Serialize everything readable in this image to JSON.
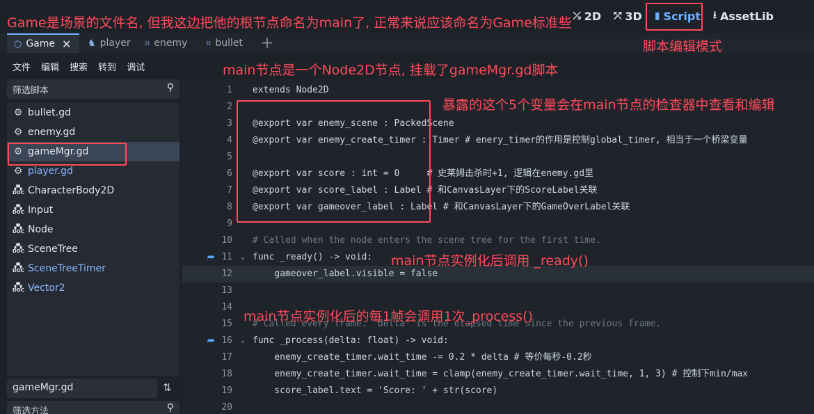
{
  "topbar": {
    "modes": [
      {
        "icon": "2d-icon",
        "label": "2D",
        "active": false
      },
      {
        "icon": "3d-icon",
        "label": "3D",
        "active": false
      },
      {
        "icon": "script-icon",
        "label": "Script",
        "active": true
      },
      {
        "icon": "assetlib-icon",
        "label": "AssetLib",
        "active": false
      }
    ]
  },
  "tabs": [
    {
      "label": "Game",
      "icon": "node2d-icon",
      "active": true
    },
    {
      "label": "player",
      "icon": "characterbody-icon",
      "active": false
    },
    {
      "label": "enemy",
      "icon": "node2d-icon",
      "active": false
    },
    {
      "label": "bullet",
      "icon": "node2d-icon",
      "active": false
    }
  ],
  "menu": [
    "文件",
    "编辑",
    "搜索",
    "转到",
    "调试"
  ],
  "script_filter_placeholder": "筛选脚本",
  "files": [
    {
      "label": "bullet.gd",
      "icon": "gear-icon",
      "style": "normal"
    },
    {
      "label": "enemy.gd",
      "icon": "gear-icon",
      "style": "normal"
    },
    {
      "label": "gameMgr.gd",
      "icon": "gear-icon",
      "style": "selected"
    },
    {
      "label": "player.gd",
      "icon": "gear-icon",
      "style": "blue"
    },
    {
      "label": "CharacterBody2D",
      "icon": "doc-icon",
      "style": "normal"
    },
    {
      "label": "Input",
      "icon": "doc-icon",
      "style": "normal"
    },
    {
      "label": "Node",
      "icon": "doc-icon",
      "style": "normal"
    },
    {
      "label": "SceneTree",
      "icon": "doc-icon",
      "style": "normal"
    },
    {
      "label": "SceneTreeTimer",
      "icon": "doc-icon",
      "style": "blue"
    },
    {
      "label": "Vector2",
      "icon": "doc-icon",
      "style": "blue"
    }
  ],
  "current_script": "gameMgr.gd",
  "method_filter_placeholder": "筛选方法",
  "code_lines": [
    {
      "n": "1",
      "text": "extends Node2D"
    },
    {
      "n": "2",
      "text": ""
    },
    {
      "n": "3",
      "text": "@export var enemy_scene : PackedScene"
    },
    {
      "n": "4",
      "text": "@export var enemy_create_timer : Timer # enery_timer的作用是控制global_timer, 相当于一个桥梁变量"
    },
    {
      "n": "5",
      "text": ""
    },
    {
      "n": "6",
      "text": "@export var score : int = 0     # 史莱姆击杀时+1, 逻辑在enemy.gd里"
    },
    {
      "n": "7",
      "text": "@export var score_label : Label # 和CanvasLayer下的ScoreLabel关联"
    },
    {
      "n": "8",
      "text": "@export var gameover_label : Label # 和CanvasLayer下的GameOverLabel关联"
    },
    {
      "n": "9",
      "text": ""
    },
    {
      "n": "10",
      "text": "# Called when the node enters the scene tree for the first time."
    },
    {
      "n": "11",
      "text": "func _ready() -> void:"
    },
    {
      "n": "12",
      "text": "    gameover_label.visible = false"
    },
    {
      "n": "13",
      "text": ""
    },
    {
      "n": "14",
      "text": ""
    },
    {
      "n": "15",
      "text": "# Called every frame. 'delta' is the elapsed time since the previous frame."
    },
    {
      "n": "16",
      "text": "func _process(delta: float) -> void:"
    },
    {
      "n": "17",
      "text": "    enemy_create_timer.wait_time -= 0.2 * delta # 等价每秒-0.2秒"
    },
    {
      "n": "18",
      "text": "    enemy_create_timer.wait_time = clamp(enemy_create_timer.wait_time, 1, 3) # 控制下min/max"
    },
    {
      "n": "19",
      "text": "    score_label.text = 'Score: ' + str(score)"
    },
    {
      "n": "20",
      "text": ""
    }
  ],
  "annotations": {
    "title_note": "Game是场景的文件名, 但我这边把他的根节点命名为main了, 正常来说应该命名为Game标准些",
    "script_mode": "脚本编辑模式",
    "main_node": "main节点是一个Node2D节点, 挂载了gameMgr.gd脚本",
    "exported_vars": "暴露的这个5个变量会在main节点的检查器中查看和编辑",
    "ready_note": "main节点实例化后调用 _ready()",
    "process_note": "main节点实例化后的每1帧会调用1次_process()"
  },
  "colors": {
    "annotation": "#ff4a5a",
    "accent": "#6fb0ff",
    "keyword": "#ff7085",
    "type": "#8effda",
    "comment": "#6e7883"
  }
}
